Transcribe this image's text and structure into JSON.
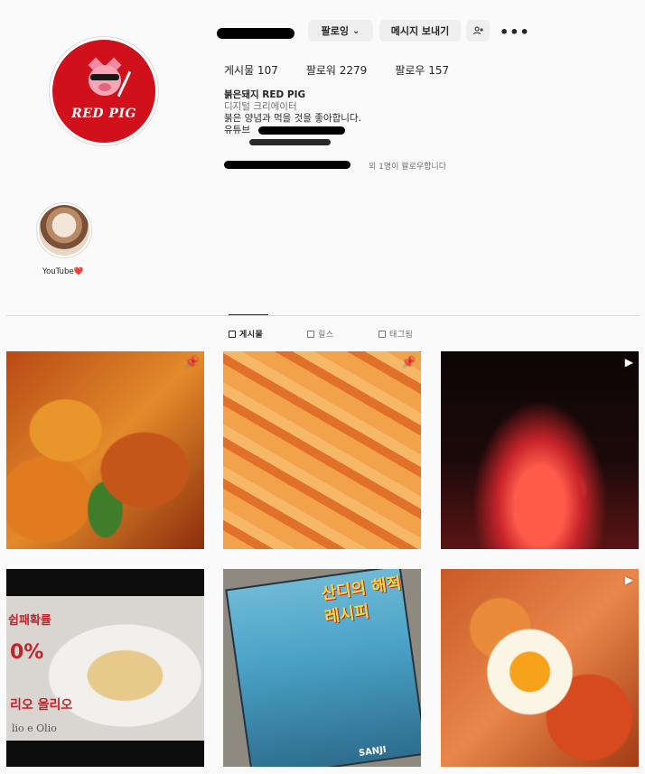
{
  "profile": {
    "follow_button": "팔로잉",
    "follow_chevron": "⌄",
    "message_button": "메시지 보내기",
    "add_user_icon": "add-user-icon",
    "more_label": "•••",
    "stats": {
      "posts": "게시물 107",
      "followers": "팔로워 2279",
      "following": "팔로우 157"
    },
    "bio": {
      "name": "붉은돼지 RED PIG",
      "category": "디지털 크리에이터",
      "line1": "붉은 양념과 먹을 것을 좋아합니다.",
      "line2": "유튜브"
    },
    "followed_by": "외 1명이 팔로우합니다",
    "avatar_text": "RED PIG"
  },
  "highlights": [
    {
      "label": "YouTube❤️"
    }
  ],
  "tabs": [
    {
      "label": "게시물",
      "icon": "grid-icon",
      "active": true
    },
    {
      "label": "릴스",
      "icon": "reels-icon",
      "active": false
    },
    {
      "label": "태그됨",
      "icon": "tagged-icon",
      "active": false
    }
  ],
  "posts": [
    {
      "badge": "📌",
      "badge_icon": "pin-icon"
    },
    {
      "badge": "📌",
      "badge_icon": "pin-icon"
    },
    {
      "badge": "▶",
      "badge_icon": "reel-icon"
    },
    {
      "top_text": "쉽패확률",
      "pct": "0%",
      "bottom_text": "리오 올리오",
      "sub_text": "lio e Olio"
    },
    {
      "title": "산디의 해적 레시피",
      "caption": "SANJI"
    },
    {
      "badge": "▶",
      "badge_icon": "reel-icon"
    }
  ],
  "colors": {
    "brand_red": "#d0101a",
    "button_bg": "#efefef",
    "text_secondary": "#737373"
  }
}
